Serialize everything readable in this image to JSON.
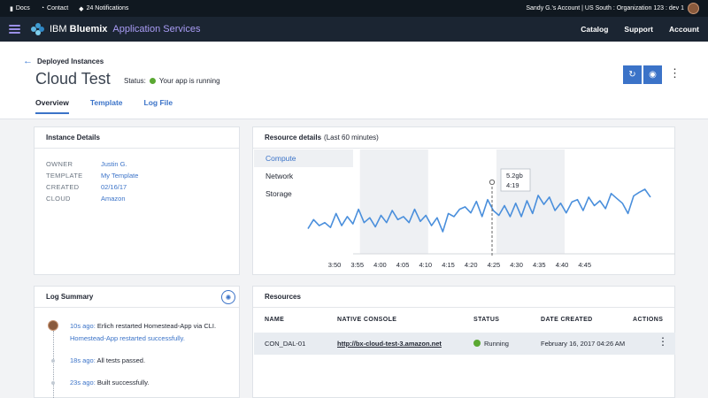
{
  "utility_bar": {
    "docs": "Docs",
    "contact": "Contact",
    "notifications": "24 Notifications",
    "account_info": "Sandy G.'s Account | US South : Organization 123 : dev 1"
  },
  "nav": {
    "brand_prefix": "IBM ",
    "brand_bold": "Bluemix",
    "app_section": "Application Services",
    "links": [
      "Catalog",
      "Support",
      "Account"
    ]
  },
  "header": {
    "back_label": "Deployed Instances",
    "title": "Cloud Test",
    "status_label": "Status:",
    "status_text": "Your app is running",
    "tabs": [
      "Overview",
      "Template",
      "Log File"
    ],
    "refresh_icon": "refresh-icon",
    "stop_icon": "stop-icon"
  },
  "instance_details": {
    "title": "Instance Details",
    "rows": [
      {
        "key": "OWNER",
        "value": "Justin G."
      },
      {
        "key": "TEMPLATE",
        "value": "My Template"
      },
      {
        "key": "CREATED",
        "value": "02/16/17"
      },
      {
        "key": "CLOUD",
        "value": "Amazon"
      }
    ]
  },
  "resource_details": {
    "title": "Resource details",
    "subtitle": "(Last 60 minutes)",
    "tabs": [
      "Compute",
      "Network",
      "Storage"
    ]
  },
  "chart_data": {
    "type": "line",
    "title": "",
    "xlabel": "",
    "ylabel": "",
    "x_ticks": [
      "3:50",
      "3:55",
      "4:00",
      "4:05",
      "4:10",
      "4:15",
      "4:20",
      "4:25",
      "4:30",
      "4:35",
      "4:40",
      "4:45"
    ],
    "series": [
      {
        "values": [
          0.3,
          0.45,
          0.35,
          0.4,
          0.32,
          0.55,
          0.35,
          0.5,
          0.38,
          0.62,
          0.4,
          0.48,
          0.33,
          0.52,
          0.4,
          0.6,
          0.45,
          0.5,
          0.4,
          0.62,
          0.42,
          0.52,
          0.35,
          0.48,
          0.25,
          0.55,
          0.5,
          0.62,
          0.66,
          0.56,
          0.75,
          0.5,
          0.78,
          0.6,
          0.52,
          0.68,
          0.5,
          0.72,
          0.5,
          0.76,
          0.55,
          0.85,
          0.7,
          0.82,
          0.6,
          0.72,
          0.56,
          0.74,
          0.78,
          0.6,
          0.82,
          0.68,
          0.76,
          0.63,
          0.88,
          0.8,
          0.72,
          0.55,
          0.84,
          0.9,
          0.95,
          0.82
        ]
      }
    ],
    "tooltip": {
      "x": "4:19",
      "value": "5.2gb",
      "time": "4:19"
    },
    "shaded_bands": [
      [
        "3:55",
        "4:10"
      ],
      [
        "4:25",
        "4:40"
      ]
    ],
    "grid": false,
    "colors": {
      "line": "#4a8fdc",
      "band": "#eef0f3",
      "marker": "#666666"
    }
  },
  "log_summary": {
    "title": "Log Summary",
    "badge_icon": "settings-icon",
    "entries": [
      {
        "time": "10s ago:",
        "text": "Erlich restarted Homestead-App via CLI.",
        "detail": "Homestead-App restarted successfully."
      },
      {
        "time": "18s ago:",
        "text": "All tests passed."
      },
      {
        "time": "23s ago:",
        "text": "Built successfully."
      }
    ]
  },
  "resources": {
    "title": "Resources",
    "columns": [
      "NAME",
      "NATIVE CONSOLE",
      "STATUS",
      "DATE CREATED",
      "ACTIONS"
    ],
    "rows": [
      {
        "name": "CON_DAL-01",
        "console": "http://bx-cloud-test-3.amazon.net",
        "status": "Running",
        "date": "February 16, 2017 04:26 AM"
      }
    ]
  }
}
